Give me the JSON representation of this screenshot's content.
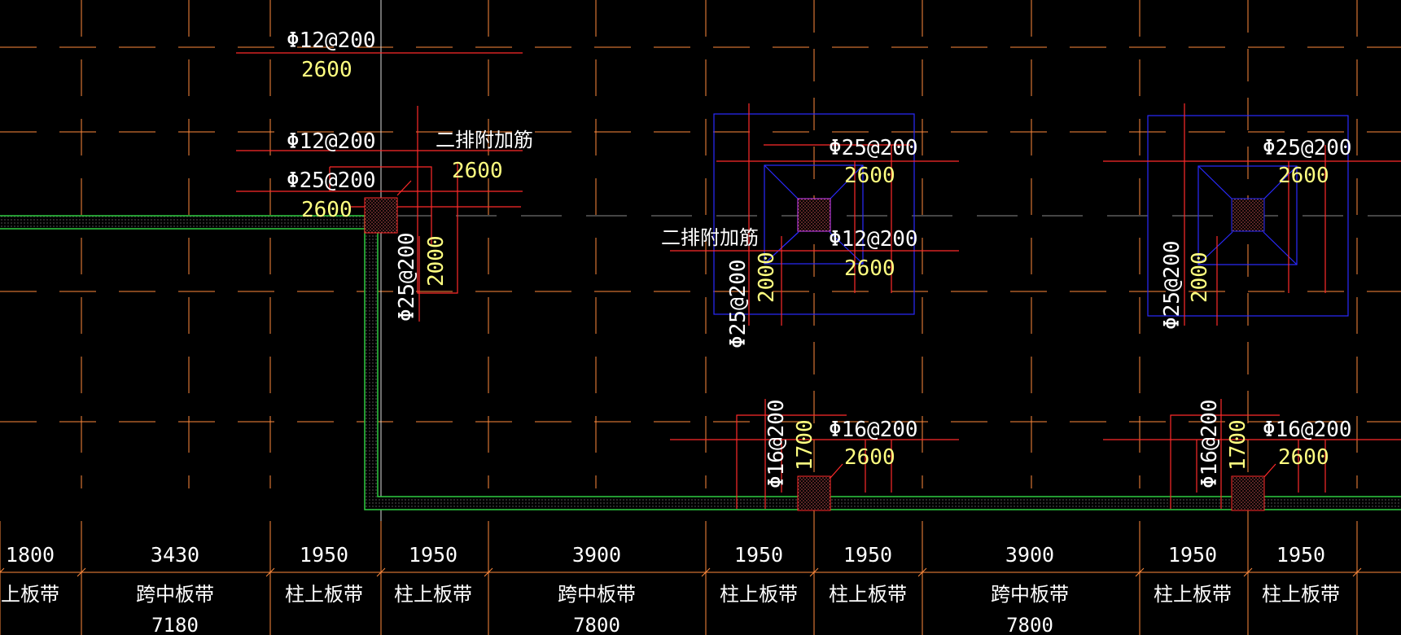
{
  "colors": {
    "background": "#000000",
    "grid": "#ff8a3d",
    "rebar": "#ff2a2a",
    "wall": "#2ecc40",
    "drop_panel": "#2a2aff",
    "label_white": "#ffffff",
    "label_yellow": "#ffff80"
  },
  "labels": {
    "left_top_spec": "Φ12@200",
    "left_top_len": "2600",
    "left_mid_spec": "Φ12@200",
    "left_mid_extra": "二排附加筋",
    "left_mid_len": "2600",
    "left_low_spec": "Φ25@200",
    "left_low_len": "2600",
    "left_vert_spec": "Φ25@200",
    "left_vert_len": "2000",
    "c1_top_spec": "Φ25@200",
    "c1_top_len": "2600",
    "c1_extra": "二排附加筋",
    "c1_mid_spec": "Φ12@200",
    "c1_mid_len": "2600",
    "c1_vert_spec": "Φ25@200",
    "c1_vert_len": "2000",
    "c1_bot_spec": "Φ16@200",
    "c1_bot_len": "2600",
    "c1_bot_vert_spec": "Φ16@200",
    "c1_bot_vert_len": "1700",
    "c2_top_spec": "Φ25@200",
    "c2_top_len": "2600",
    "c2_vert_spec": "Φ25@200",
    "c2_vert_len": "2000",
    "c2_bot_spec": "Φ16@200",
    "c2_bot_len": "2600",
    "c2_bot_vert_spec": "Φ16@200",
    "c2_bot_vert_len": "1700"
  },
  "dimensions": [
    "1800",
    "3430",
    "1950",
    "1950",
    "3900",
    "1950",
    "1950",
    "3900",
    "1950",
    "1950"
  ],
  "strips": [
    {
      "name": "柱上板带",
      "span": ""
    },
    {
      "name": "跨中板带",
      "span": "7180"
    },
    {
      "name": "柱上板带",
      "span": ""
    },
    {
      "name": "柱上板带",
      "span": ""
    },
    {
      "name": "跨中板带",
      "span": "7800"
    },
    {
      "name": "柱上板带",
      "span": ""
    },
    {
      "name": "柱上板带",
      "span": ""
    },
    {
      "name": "跨中板带",
      "span": "7800"
    },
    {
      "name": "柱上板带",
      "span": ""
    },
    {
      "name": "柱上板带",
      "span": ""
    }
  ]
}
